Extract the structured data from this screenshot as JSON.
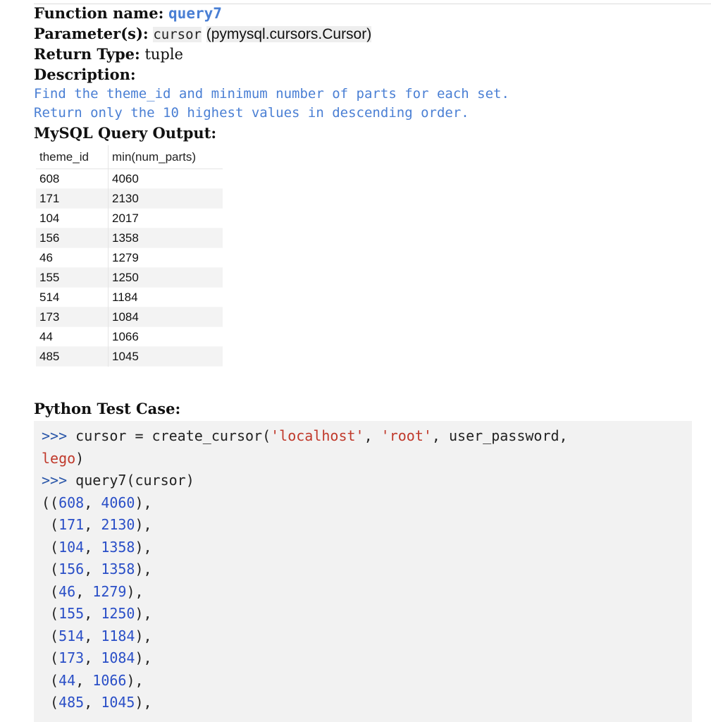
{
  "function": {
    "name_label": "Function name:",
    "name": "query7",
    "params_label": "Parameter(s):",
    "param_name": "cursor",
    "param_type_open": "(",
    "param_type": "pymysql.cursors.Cursor",
    "param_type_close": ")",
    "return_label": "Return Type:",
    "return_type": "tuple",
    "description_label": "Description:",
    "description_lines": [
      "Find the theme_id and minimum number of parts for each set.",
      "Return only the 10 highest values in descending order."
    ]
  },
  "mysql_output": {
    "title": "MySQL Query Output:",
    "columns": [
      "theme_id",
      "min(num_parts)"
    ],
    "rows": [
      [
        "608",
        "4060"
      ],
      [
        "171",
        "2130"
      ],
      [
        "104",
        "2017"
      ],
      [
        "156",
        "1358"
      ],
      [
        "46",
        "1279"
      ],
      [
        "155",
        "1250"
      ],
      [
        "514",
        "1184"
      ],
      [
        "173",
        "1084"
      ],
      [
        "44",
        "1066"
      ],
      [
        "485",
        "1045"
      ]
    ]
  },
  "test_case": {
    "title": "Python Test Case:",
    "prompt": ">>>",
    "line1_code": " cursor = create_cursor(",
    "str_localhost": "'localhost'",
    "sep": ", ",
    "str_root": "'root'",
    "line1_tail": ", user_password,",
    "str_lego": "lego",
    "close_paren": ")",
    "line2_code": " query7(cursor)",
    "result_open": "(",
    "tuples": [
      [
        "608",
        "4060"
      ],
      [
        "171",
        "2130"
      ],
      [
        "104",
        "1358"
      ],
      [
        "156",
        "1358"
      ],
      [
        "46",
        "1279"
      ],
      [
        "155",
        "1250"
      ],
      [
        "514",
        "1184"
      ],
      [
        "173",
        "1084"
      ],
      [
        "44",
        "1066"
      ],
      [
        "485",
        "1045"
      ]
    ]
  }
}
